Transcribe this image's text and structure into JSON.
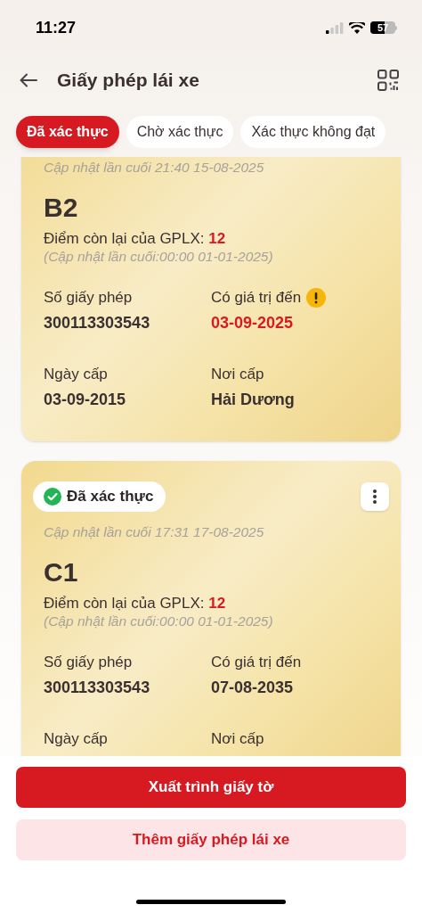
{
  "status_bar": {
    "time": "11:27",
    "battery": "57"
  },
  "header": {
    "title": "Giấy phép lái xe"
  },
  "tabs": [
    {
      "label": "Đã xác thực",
      "selected": true
    },
    {
      "label": "Chờ xác thực",
      "selected": false
    },
    {
      "label": "Xác thực không đạt",
      "selected": false
    }
  ],
  "cards": [
    {
      "updated": "Cập nhật lần cuối 21:40 15-08-2025",
      "class": "B2",
      "points_label": "Điểm còn lại của GPLX:",
      "points": "12",
      "points_updated": "(Cập nhật lần cuối:00:00 01-01-2025)",
      "fields": [
        {
          "label": "Số giấy phép",
          "value": "300113303543",
          "warning": false
        },
        {
          "label": "Có giá trị đến",
          "value": "03-09-2025",
          "warning": true
        },
        {
          "label": "Ngày cấp",
          "value": "03-09-2015",
          "warning": false
        },
        {
          "label": "Nơi cấp",
          "value": "Hải Dương",
          "warning": false
        }
      ]
    },
    {
      "badge": "Đã xác thực",
      "updated": "Cập nhật lần cuối 17:31 17-08-2025",
      "class": "C1",
      "points_label": "Điểm còn lại của GPLX:",
      "points": "12",
      "points_updated": "(Cập nhật lần cuối:00:00 01-01-2025)",
      "fields": [
        {
          "label": "Số giấy phép",
          "value": "300113303543",
          "warning": false
        },
        {
          "label": "Có giá trị đến",
          "value": "07-08-2035",
          "warning": false
        },
        {
          "label": "Ngày cấp"
        },
        {
          "label": "Nơi cấp"
        }
      ]
    }
  ],
  "buttons": [
    {
      "label": "Xuất trình giấy tờ",
      "kind": "primary"
    },
    {
      "label": "Thêm giấy phép lái xe",
      "kind": "secondary"
    }
  ]
}
